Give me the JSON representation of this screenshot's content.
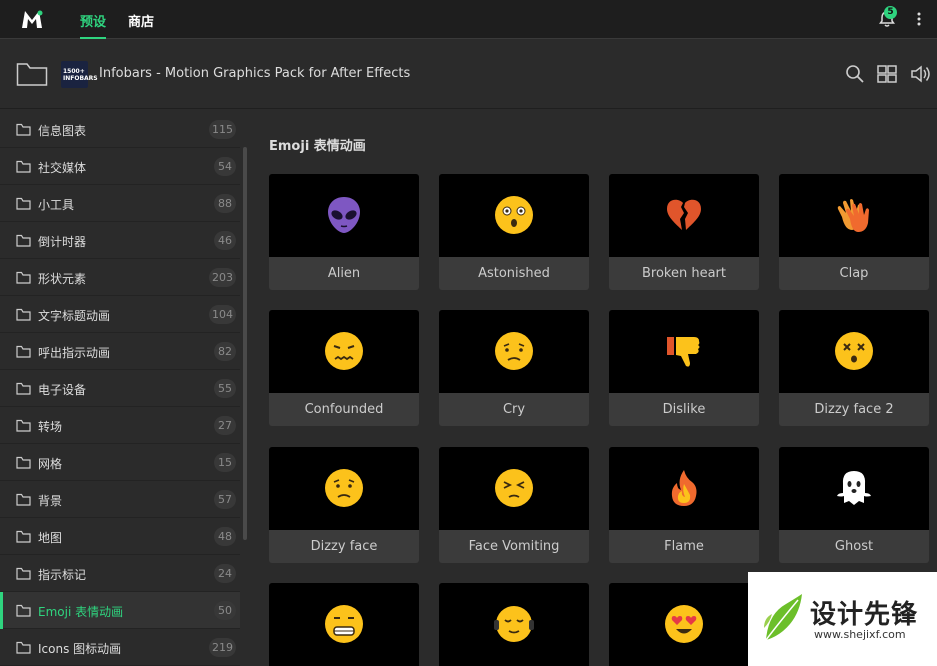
{
  "topbar": {
    "tabs": [
      {
        "label": "预设",
        "active": true
      },
      {
        "label": "商店",
        "active": false
      }
    ],
    "notification_count": "5",
    "accent": "#2fd47f"
  },
  "header": {
    "thumb_text": "1500+ INFOBARS",
    "title": "Infobars - Motion Graphics Pack for After Effects"
  },
  "sidebar": {
    "items": [
      {
        "label": "信息图表",
        "count": "115"
      },
      {
        "label": "社交媒体",
        "count": "54"
      },
      {
        "label": "小工具",
        "count": "88"
      },
      {
        "label": "倒计时器",
        "count": "46"
      },
      {
        "label": "形状元素",
        "count": "203"
      },
      {
        "label": "文字标题动画",
        "count": "104"
      },
      {
        "label": "呼出指示动画",
        "count": "82"
      },
      {
        "label": "电子设备",
        "count": "55"
      },
      {
        "label": "转场",
        "count": "27"
      },
      {
        "label": "网格",
        "count": "15"
      },
      {
        "label": "背景",
        "count": "57"
      },
      {
        "label": "地图",
        "count": "48"
      },
      {
        "label": "指示标记",
        "count": "24"
      },
      {
        "label": "Emoji 表情动画",
        "count": "50",
        "active": true
      },
      {
        "label": "Icons 图标动画",
        "count": "219"
      }
    ]
  },
  "main": {
    "section_title": "Emoji 表情动画",
    "cards": [
      {
        "label": "Alien",
        "icon": "alien-icon"
      },
      {
        "label": "Astonished",
        "icon": "astonished-face-icon"
      },
      {
        "label": "Broken heart",
        "icon": "broken-heart-icon"
      },
      {
        "label": "Clap",
        "icon": "clap-icon"
      },
      {
        "label": "Confounded",
        "icon": "confounded-face-icon"
      },
      {
        "label": "Cry",
        "icon": "cry-face-icon"
      },
      {
        "label": "Dislike",
        "icon": "thumbs-down-icon"
      },
      {
        "label": "Dizzy face 2",
        "icon": "dizzy-face-icon"
      },
      {
        "label": "Dizzy face",
        "icon": "frowning-face-icon"
      },
      {
        "label": "Face Vomiting",
        "icon": "squint-face-icon"
      },
      {
        "label": "Flame",
        "icon": "flame-icon"
      },
      {
        "label": "Ghost",
        "icon": "ghost-icon"
      },
      {
        "label": "",
        "icon": "grimace-face-icon"
      },
      {
        "label": "",
        "icon": "headphones-face-icon"
      },
      {
        "label": "",
        "icon": "heart-eyes-face-icon"
      }
    ]
  },
  "watermark": {
    "text": "设计先锋",
    "url": "www.shejixf.com"
  }
}
